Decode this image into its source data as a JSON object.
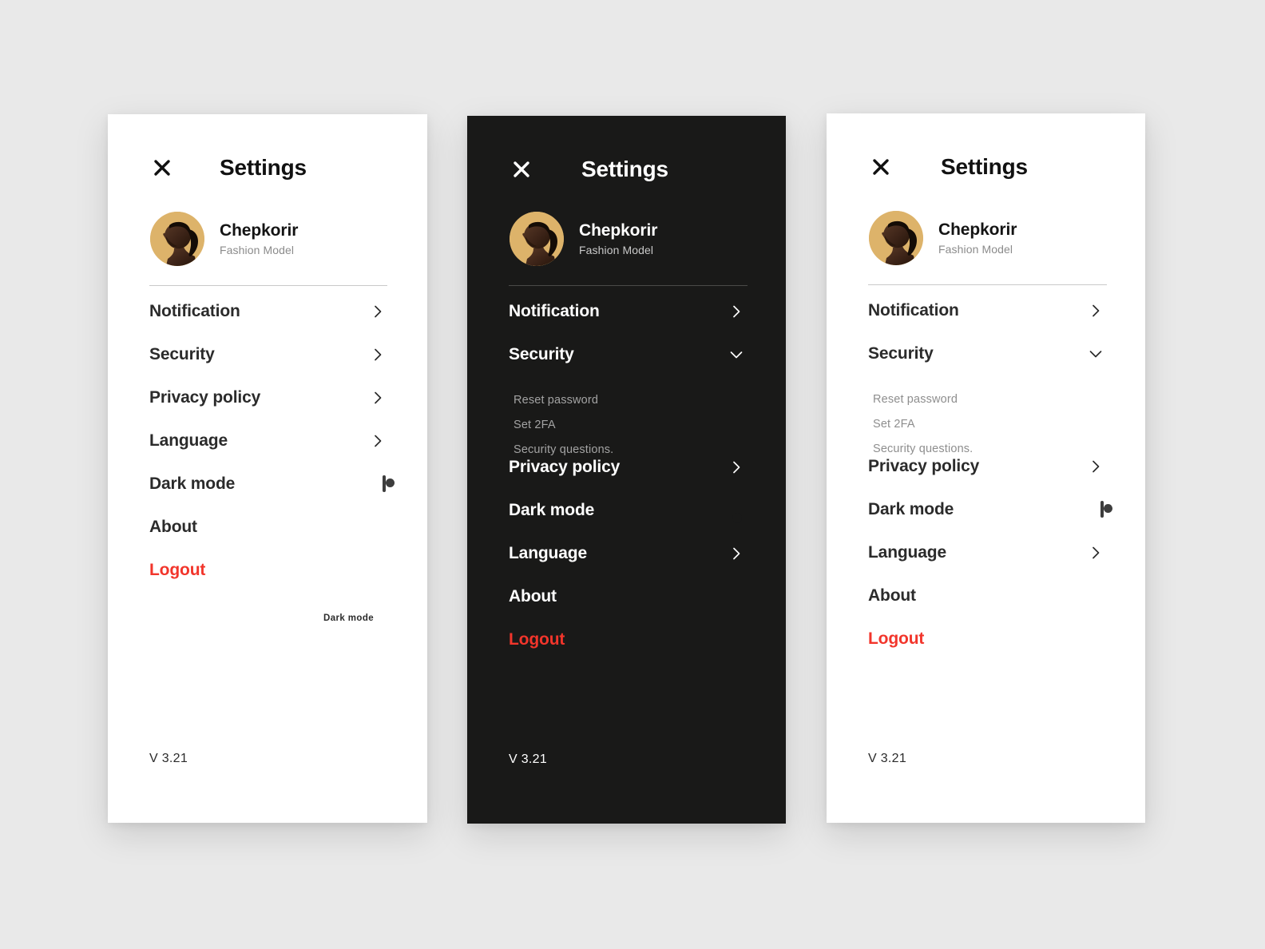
{
  "theme": {
    "page_bg": "#e9e9e9",
    "light_panel_bg": "#ffffff",
    "dark_panel_bg": "#191918",
    "accent_avatar": "#ddb36a",
    "danger": "#f2352b",
    "light_text": "#2b2b2b",
    "dark_text": "#ffffff",
    "muted_light": "#8e8e8e",
    "muted_dark": "#a3a3a3"
  },
  "common": {
    "close_icon": "close-x-icon",
    "chevron_right_icon": "chevron-right-icon",
    "chevron_down_icon": "chevron-down-icon",
    "toggle_on_state": "on",
    "toggle_off_state": "off"
  },
  "panels": [
    {
      "id": "panel-light-collapsed",
      "mode": "light",
      "header": {
        "title": "Settings",
        "close_label": "✕"
      },
      "profile": {
        "name": "Chepkorir",
        "role": "Fashion Model",
        "avatar_alt": "avatar"
      },
      "menu": [
        {
          "label": "Notification",
          "type": "link",
          "icon": "chevron-right-icon"
        },
        {
          "label": "Security",
          "type": "link",
          "icon": "chevron-right-icon"
        },
        {
          "label": "Privacy policy",
          "type": "link",
          "icon": "chevron-right-icon"
        },
        {
          "label": "Language",
          "type": "link",
          "icon": "chevron-right-icon"
        },
        {
          "label": "Dark mode",
          "type": "toggle",
          "state": "off"
        },
        {
          "label": "About",
          "type": "plain"
        },
        {
          "label": "Logout",
          "type": "danger"
        }
      ],
      "annotation": "Dark mode",
      "version": "V 3.21"
    },
    {
      "id": "panel-dark-expanded",
      "mode": "dark",
      "header": {
        "title": "Settings",
        "close_label": "✕"
      },
      "profile": {
        "name": "Chepkorir",
        "role": "Fashion Model",
        "avatar_alt": "avatar"
      },
      "menu": [
        {
          "label": "Notification",
          "type": "link",
          "icon": "chevron-right-icon"
        },
        {
          "label": "Security",
          "type": "link",
          "icon": "chevron-down-icon"
        },
        {
          "label": "Reset password",
          "type": "sub"
        },
        {
          "label": "Set 2FA",
          "type": "sub"
        },
        {
          "label": "Security questions.",
          "type": "sub"
        },
        {
          "label": "Privacy policy",
          "type": "link",
          "icon": "chevron-right-icon"
        },
        {
          "label": "Dark mode",
          "type": "toggle",
          "state": "on"
        },
        {
          "label": "Language",
          "type": "link",
          "icon": "chevron-right-icon"
        },
        {
          "label": "About",
          "type": "plain"
        },
        {
          "label": "Logout",
          "type": "danger"
        }
      ],
      "annotation": "",
      "version": "V 3.21"
    },
    {
      "id": "panel-light-expanded",
      "mode": "light",
      "header": {
        "title": "Settings",
        "close_label": "✕"
      },
      "profile": {
        "name": "Chepkorir",
        "role": "Fashion Model",
        "avatar_alt": "avatar"
      },
      "menu": [
        {
          "label": "Notification",
          "type": "link",
          "icon": "chevron-right-icon"
        },
        {
          "label": "Security",
          "type": "link",
          "icon": "chevron-down-icon"
        },
        {
          "label": "Reset password",
          "type": "sub"
        },
        {
          "label": "Set 2FA",
          "type": "sub"
        },
        {
          "label": "Security questions.",
          "type": "sub"
        },
        {
          "label": "Privacy policy",
          "type": "link",
          "icon": "chevron-right-icon"
        },
        {
          "label": "Dark mode",
          "type": "toggle",
          "state": "off"
        },
        {
          "label": "Language",
          "type": "link",
          "icon": "chevron-right-icon"
        },
        {
          "label": "About",
          "type": "plain"
        },
        {
          "label": "Logout",
          "type": "danger"
        }
      ],
      "annotation": "",
      "version": "V 3.21"
    }
  ]
}
